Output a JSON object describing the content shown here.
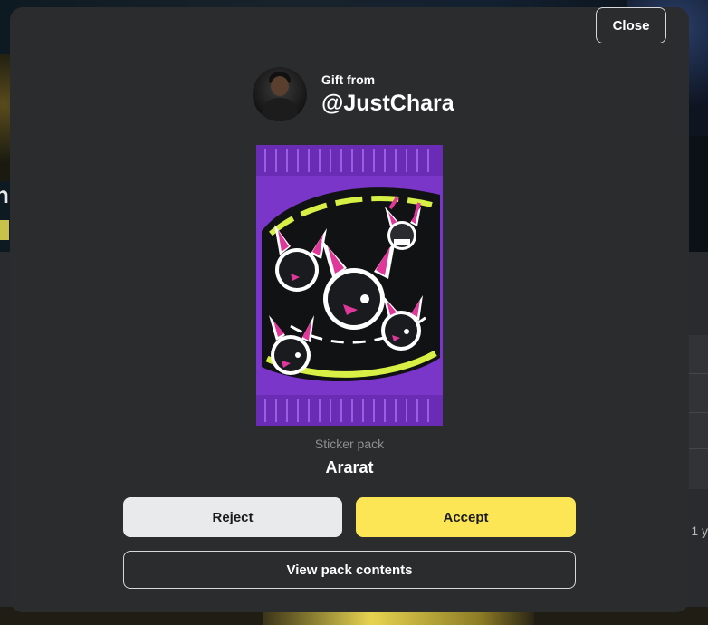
{
  "background": {
    "left_heading_fragment": "n",
    "right_text_fragment": "1 y"
  },
  "modal": {
    "close_label": "Close",
    "gift_from_label": "Gift from",
    "sender_username": "@JustChara",
    "pack_type": "Sticker pack",
    "pack_name": "Ararat",
    "reject_label": "Reject",
    "accept_label": "Accept",
    "view_contents_label": "View pack contents"
  },
  "colors": {
    "modal_bg": "#2b2c2e",
    "accept": "#fde655",
    "reject": "#e9eaec",
    "pack_purple": "#7a35c9",
    "sticker_pink": "#e0389a",
    "accent_lime": "#d8f046"
  },
  "icons": {
    "avatar": "user-avatar-photo",
    "pack_art": "sticker-pack-wrapper"
  }
}
